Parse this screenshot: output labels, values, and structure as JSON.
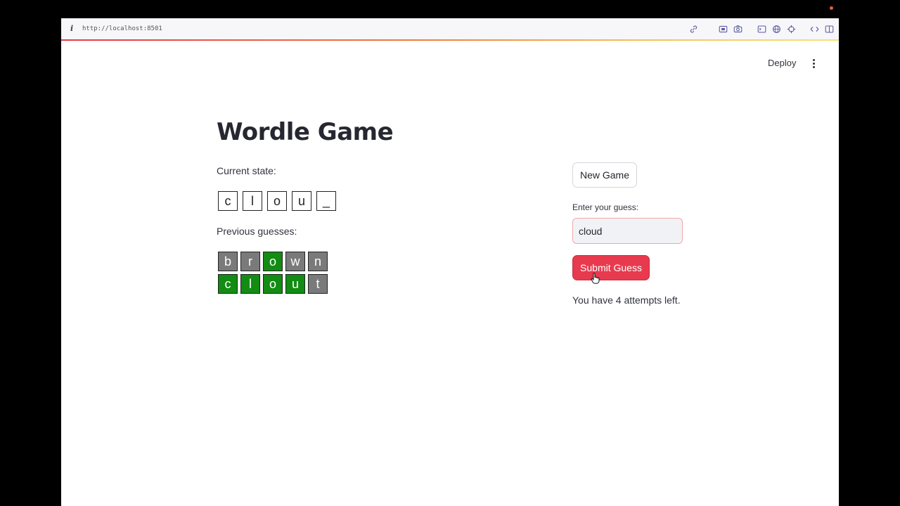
{
  "browser": {
    "url": "http://localhost:8501"
  },
  "header": {
    "deploy_label": "Deploy"
  },
  "app": {
    "title": "Wordle Game",
    "current_state_label": "Current state:",
    "current_state": [
      "c",
      "l",
      "o",
      "u",
      "_"
    ],
    "previous_label": "Previous guesses:",
    "previous_guesses": [
      [
        {
          "letter": "b",
          "status": "absent"
        },
        {
          "letter": "r",
          "status": "absent"
        },
        {
          "letter": "o",
          "status": "correct"
        },
        {
          "letter": "w",
          "status": "absent"
        },
        {
          "letter": "n",
          "status": "absent"
        }
      ],
      [
        {
          "letter": "c",
          "status": "correct"
        },
        {
          "letter": "l",
          "status": "correct"
        },
        {
          "letter": "o",
          "status": "correct"
        },
        {
          "letter": "u",
          "status": "correct"
        },
        {
          "letter": "t",
          "status": "absent"
        }
      ]
    ],
    "new_game_label": "New Game",
    "guess_label": "Enter your guess:",
    "guess_value": "cloud",
    "submit_label": "Submit Guess",
    "attempts_text": "You have 4 attempts left."
  },
  "colors": {
    "correct": "#128c12",
    "absent": "#7a7a7a",
    "primary": "#e83a4e"
  }
}
